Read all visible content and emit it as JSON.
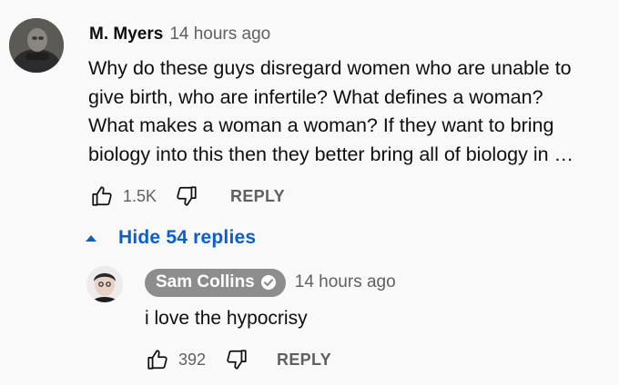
{
  "main_comment": {
    "author": "M. Myers",
    "timestamp": "14 hours ago",
    "text_lines": [
      "Why do these guys disregard women who are unable to",
      "give birth, who are infertile? What defines a woman?",
      "What makes a woman a woman? If they want to bring",
      "biology into this then they better bring all of biology in …"
    ],
    "likes": "1.5K",
    "reply_label": "REPLY"
  },
  "replies_toggle": {
    "label": "Hide 54 replies",
    "icon": "caret-up-icon"
  },
  "reply_comment": {
    "author": "Sam Collins",
    "verified_icon": "verified-check-icon",
    "timestamp": "14 hours ago",
    "text": "i love the hypocrisy",
    "likes": "392",
    "reply_label": "REPLY"
  },
  "colors": {
    "background": "#f9f9f9",
    "link_blue": "#065fd4",
    "secondary_text": "#606060",
    "author_chip": "#8d8d8d"
  }
}
